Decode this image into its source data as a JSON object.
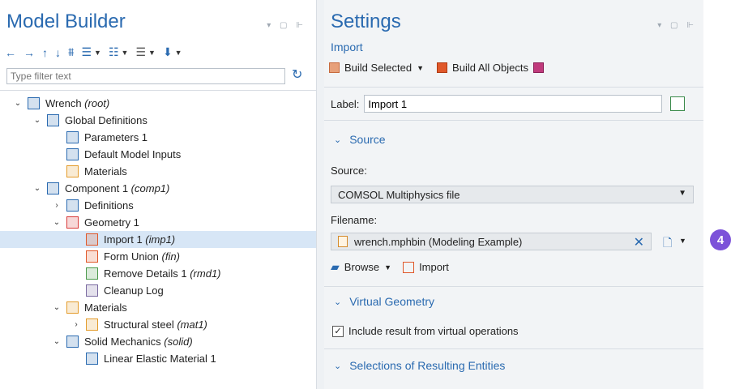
{
  "model_builder": {
    "title": "Model Builder",
    "filter_placeholder": "Type filter text",
    "tree": [
      {
        "label": "Wrench",
        "tag": "(root)",
        "icon": "wrench-model-icon",
        "toggle": "down",
        "depth": 0
      },
      {
        "label": "Global Definitions",
        "tag": "",
        "icon": "globe-icon",
        "toggle": "down",
        "depth": 1
      },
      {
        "label": "Parameters 1",
        "tag": "",
        "icon": "parameters-icon",
        "toggle": "",
        "depth": 2
      },
      {
        "label": "Default Model Inputs",
        "tag": "",
        "icon": "model-inputs-icon",
        "toggle": "",
        "depth": 2
      },
      {
        "label": "Materials",
        "tag": "",
        "icon": "materials-icon",
        "toggle": "",
        "depth": 2
      },
      {
        "label": "Component 1",
        "tag": "(comp1)",
        "icon": "component-icon",
        "toggle": "down",
        "depth": 1
      },
      {
        "label": "Definitions",
        "tag": "",
        "icon": "definitions-icon",
        "toggle": "right",
        "depth": 2
      },
      {
        "label": "Geometry 1",
        "tag": "",
        "icon": "geometry-icon",
        "toggle": "down",
        "depth": 2
      },
      {
        "label": "Import 1",
        "tag": "(imp1)",
        "icon": "import-icon",
        "toggle": "",
        "depth": 3,
        "selected": true
      },
      {
        "label": "Form Union",
        "tag": "(fin)",
        "icon": "form-union-icon",
        "toggle": "",
        "depth": 3
      },
      {
        "label": "Remove Details 1",
        "tag": "(rmd1)",
        "icon": "remove-details-icon",
        "toggle": "",
        "depth": 3
      },
      {
        "label": "Cleanup Log",
        "tag": "",
        "icon": "cleanup-log-icon",
        "toggle": "",
        "depth": 3
      },
      {
        "label": "Materials",
        "tag": "",
        "icon": "materials-node-icon",
        "toggle": "down",
        "depth": 2
      },
      {
        "label": "Structural steel",
        "tag": "(mat1)",
        "icon": "material-icon",
        "toggle": "right",
        "depth": 3
      },
      {
        "label": "Solid Mechanics",
        "tag": "(solid)",
        "icon": "solid-mechanics-icon",
        "toggle": "down",
        "depth": 2
      },
      {
        "label": "Linear Elastic Material 1",
        "tag": "",
        "icon": "linear-elastic-icon",
        "toggle": "",
        "depth": 3
      }
    ]
  },
  "settings": {
    "title": "Settings",
    "subtitle": "Import",
    "build_selected": "Build Selected",
    "build_all": "Build All Objects",
    "label_caption": "Label:",
    "label_value": "Import 1",
    "source_section": "Source",
    "source_caption": "Source:",
    "source_value": "COMSOL Multiphysics file",
    "filename_caption": "Filename:",
    "filename_value": "wrench.mphbin (Modeling Example)",
    "browse": "Browse",
    "import": "Import",
    "virtual_section": "Virtual Geometry",
    "virtual_checkbox": "Include result from virtual operations",
    "virtual_checked": true,
    "selections_section": "Selections of Resulting Entities"
  },
  "callout": "4",
  "colors": {
    "accent": "#2a6ab0",
    "selected_row": "#d7e6f6",
    "callout": "#7c52d9"
  }
}
